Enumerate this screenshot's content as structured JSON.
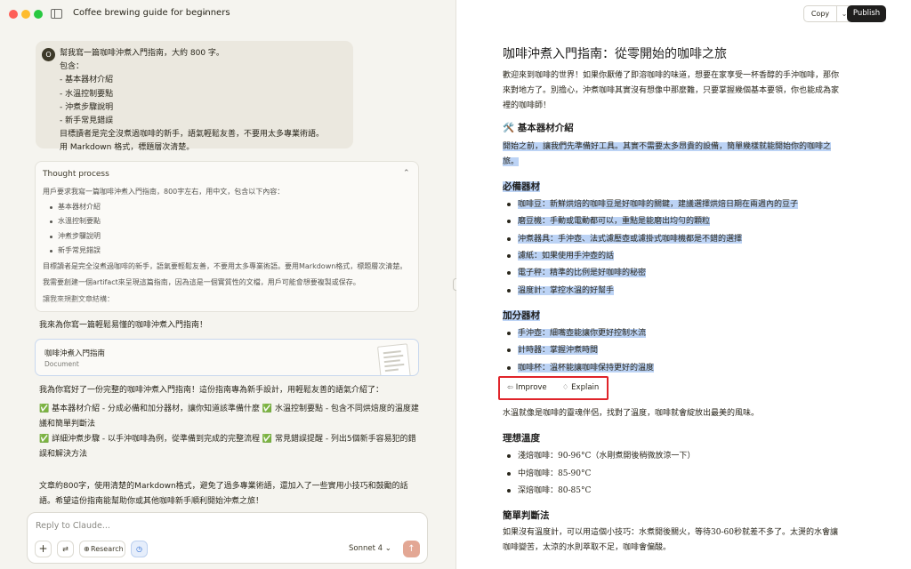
{
  "window": {
    "chat_title": "Coffee brewing guide for beginners"
  },
  "user_message": {
    "avatar": "O",
    "lines": [
      "幫我寫一篇咖啡沖煮入門指南，大約 800 字。",
      "包含：",
      "- 基本器材介紹",
      "- 水溫控制要點",
      "- 沖煮步驟說明",
      "- 新手常見錯誤",
      "目標讀者是完全沒煮過咖啡的新手，語氣輕鬆友善，不要用太多專業術語。",
      "用 Markdown 格式，標題層次清楚。"
    ]
  },
  "thought": {
    "title": "Thought process",
    "intro": "用戶要求我寫一篇咖啡沖煮入門指南，800字左右，用中文，包含以下內容：",
    "bullets": [
      "基本器材介紹",
      "水溫控制要點",
      "沖煮步驟說明",
      "新手常見錯誤"
    ],
    "para1": "目標讀者是完全沒煮過咖啡的新手，語氣要輕鬆友善，不要用太多專業術語。要用Markdown格式，標題層次清楚。",
    "para2": "我需要創建一個artifact來呈現這篇指南，因為這是一個實質性的文檔，用戶可能會想要複製或保存。",
    "para3": "讓我來規劃文章結構："
  },
  "reply": {
    "intro": "我來為你寫一篇輕鬆易懂的咖啡沖煮入門指南！",
    "artifact_title": "咖啡沖煮入門指南",
    "artifact_type": "Document",
    "body": "我為你寫好了一份完整的咖啡沖煮入門指南！這份指南專為新手設計，用輕鬆友善的語氣介紹了：",
    "check1": "✅ 基本器材介紹 - 分成必備和加分器材，讓你知道該準備什麼 ✅ 水溫控制要點 - 包含不同烘焙度的溫度建議和簡單判斷法",
    "check2": "✅ 詳細沖煮步驟 - 以手沖咖啡為例，從準備到完成的完整流程 ✅ 常見錯誤提醒 - 列出5個新手容易犯的錯誤和解決方法",
    "summary": "文章約800字，使用清楚的Markdown格式，避免了過多專業術語，還加入了一些實用小技巧和鼓勵的話語。希望這份指南能幫助你或其他咖啡新手順利開始沖煮之旅！"
  },
  "composer": {
    "placeholder": "Reply to Claude...",
    "plus": "+",
    "tools": "⇄",
    "research": "Research",
    "research_icon": "⊕",
    "clock": "◷",
    "model": "Sonnet 4 ⌄",
    "send": "↑"
  },
  "artifact_header": {
    "copy": "Copy",
    "copy_chev": "⌄",
    "publish": "Publish"
  },
  "document": {
    "h1": "咖啡沖煮入門指南：從零開始的咖啡之旅",
    "intro_line1": "歡迎來到咖啡的世界！如果你厭倦了即溶咖啡的味道，想要在家享受一杯香醇的手沖咖啡，那你",
    "intro_line2": "來對地方了。別擔心，沖煮咖啡其實沒有想像中那麼難，只要掌握幾個基本要領，你也能成為家",
    "intro_line3": "裡的咖啡師！",
    "h2_equipment": "🛠️ 基本器材介紹",
    "equip_line1": "開始之前，讓我們先準備好工具。其實不需要太多昂貴的設備，簡單幾樣就能開始你的咖啡之",
    "equip_line2": "旅。",
    "h3_essential": "必備器材",
    "essential": [
      "咖啡豆：新鮮烘焙的咖啡豆是好咖啡的關鍵，建議選擇烘焙日期在兩週內的豆子",
      "磨豆機：手動或電動都可以，重點是能磨出均勻的顆粒",
      "沖煮器具：手沖壺、法式濾壓壺或濾掛式咖啡機都是不錯的選擇",
      "濾紙：如果使用手沖壺的話",
      "電子秤：精準的比例是好咖啡的秘密",
      "溫度計：掌控水溫的好幫手"
    ],
    "h3_bonus": "加分器材",
    "bonus": [
      "手沖壺：細嘴壺能讓你更好控制水流",
      "計時器：掌握沖煮時間",
      "咖啡杯：溫杯能讓咖啡保持更好的溫度"
    ],
    "toolbar_improve": "Improve",
    "toolbar_explain": "Explain",
    "water_text": "水溫就像是咖啡的靈魂伴侶，找對了溫度，咖啡就會綻放出最美的風味。",
    "h3_temp": "理想溫度",
    "temps": [
      "淺焙咖啡：90-96°C（水剛煮開後稍微放涼一下）",
      "中焙咖啡：85-90°C",
      "深焙咖啡：80-85°C"
    ],
    "h3_judge": "簡單判斷法",
    "judge_line1": "如果沒有溫度計，可以用這個小技巧：水煮開後關火，等待30-60秒就差不多了。太燙的水會讓",
    "judge_line2": "咖啡變苦，太涼的水則萃取不足，咖啡會偏酸。"
  }
}
